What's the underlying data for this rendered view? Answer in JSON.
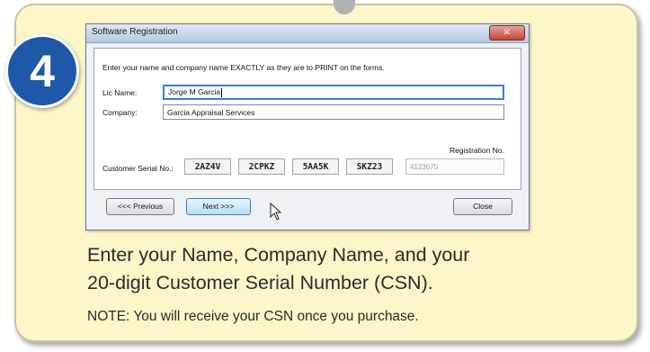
{
  "step_number": "4",
  "dialog": {
    "title": "Software Registration",
    "close_icon": "close-x-icon",
    "instruction": "Enter your name and company name EXACTLY as they are to PRINT on the forms.",
    "lic_name_label": "Lic Name:",
    "lic_name_value": "Jorge M Garcia",
    "company_label": "Company:",
    "company_value": "Garcia Appraisal Services",
    "serial_label": "Customer Serial No.:",
    "serial_parts": [
      "2AZ4V",
      "2CPKZ",
      "5AA5K",
      "SKZ23"
    ],
    "regno_label": "Registration No.",
    "regno_value": "4123675",
    "prev_button": "<<< Previous",
    "next_button": "Next >>>",
    "close_button": "Close"
  },
  "caption": {
    "line1": "Enter your Name, Company Name, and your",
    "line2": "20-digit Customer Serial Number (CSN).",
    "note": "NOTE: You will receive your CSN once you purchase."
  },
  "colors": {
    "card_background": "#fdf6c9",
    "badge": "#1f58a8",
    "primary_button": "#b8dff6"
  }
}
